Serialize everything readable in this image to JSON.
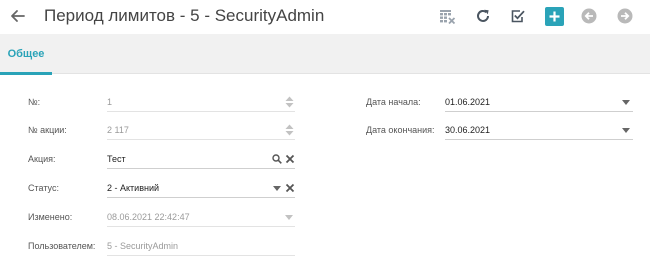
{
  "header": {
    "title": "Период лимитов - 5 - SecurityAdmin",
    "back_icon": "arrow-left-icon",
    "toolbar": [
      {
        "name": "clear-filter-button",
        "icon": "table-clear-icon",
        "color": "#9aa3ad",
        "enabled": true
      },
      {
        "name": "refresh-button",
        "icon": "refresh-icon",
        "color": "#4a5560",
        "enabled": true
      },
      {
        "name": "save-button",
        "icon": "checkbox-icon",
        "color": "#4a5560",
        "enabled": true
      },
      {
        "name": "add-button",
        "icon": "plus-icon",
        "color": "#2aa3b8",
        "enabled": true
      },
      {
        "name": "prev-button",
        "icon": "circle-arrow-left-icon",
        "color": "#b9b9b9",
        "enabled": false
      },
      {
        "name": "next-button",
        "icon": "circle-arrow-right-icon",
        "color": "#b9b9b9",
        "enabled": false
      }
    ]
  },
  "tabs": [
    {
      "label": "Общее",
      "active": true
    }
  ],
  "form": {
    "number": {
      "label": "№:",
      "value": "1"
    },
    "action_number": {
      "label": "№ акции:",
      "value": "2 117"
    },
    "action": {
      "label": "Акция:",
      "value": "Тест"
    },
    "status": {
      "label": "Статус:",
      "value": "2 - Активний"
    },
    "modified": {
      "label": "Изменено:",
      "value": "08.06.2021 22:42:47"
    },
    "user": {
      "label": "Пользователем:",
      "value": "5 - SecurityAdmin"
    },
    "date_start": {
      "label": "Дата начала:",
      "value": "01.06.2021"
    },
    "date_end": {
      "label": "Дата окончания:",
      "value": "30.06.2021"
    }
  },
  "colors": {
    "accent": "#2aa3b8",
    "tab_bar_bg": "#f1f1f1"
  }
}
